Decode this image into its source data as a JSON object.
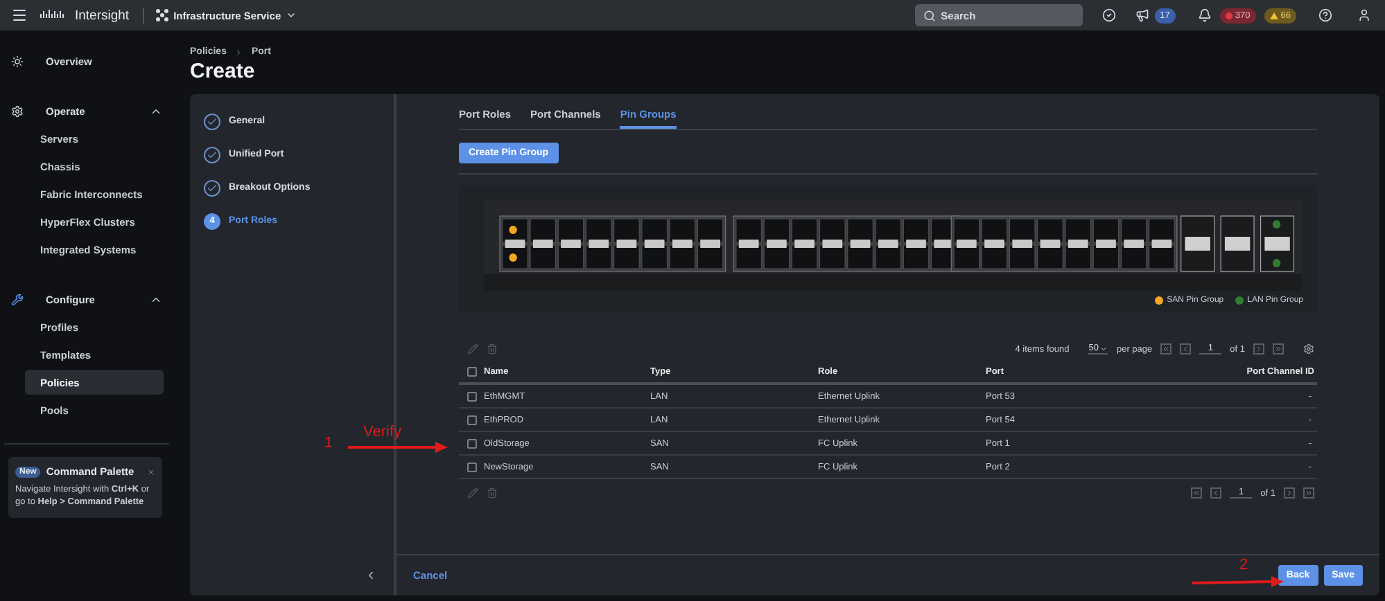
{
  "topbar": {
    "product": "Intersight",
    "service": "Infrastructure Service",
    "search": {
      "placeholder": "Search"
    },
    "badges": [
      {
        "kind": "info",
        "text": "17"
      },
      {
        "kind": "critical",
        "text": "370"
      },
      {
        "kind": "warning",
        "text": "66"
      }
    ]
  },
  "sidebar": {
    "sections": [
      {
        "label": "Overview",
        "expanded": false
      },
      {
        "label": "Operate",
        "expanded": true,
        "children": [
          {
            "label": "Servers",
            "selected": false
          },
          {
            "label": "Chassis",
            "selected": false
          },
          {
            "label": "Fabric Interconnects",
            "selected": false
          },
          {
            "label": "HyperFlex Clusters",
            "selected": false
          },
          {
            "label": "Integrated Systems",
            "selected": false
          }
        ]
      },
      {
        "label": "Configure",
        "expanded": true,
        "children": [
          {
            "label": "Profiles",
            "selected": false
          },
          {
            "label": "Templates",
            "selected": false
          },
          {
            "label": "Policies",
            "selected": true
          },
          {
            "label": "Pools",
            "selected": false
          }
        ]
      }
    ],
    "promo": {
      "badge": "New",
      "title": "Command Palette",
      "body": "Navigate Intersight with **Ctrl+K** or go to **Help > Command Palette**"
    }
  },
  "breadcrumb": [
    "Policies",
    "Port"
  ],
  "title": "Create",
  "steps": [
    {
      "label": "General",
      "completed": true,
      "selected": false
    },
    {
      "label": "Unified Port",
      "completed": true,
      "selected": false
    },
    {
      "label": "Breakout Options",
      "completed": true,
      "selected": false
    },
    {
      "label": "Port Roles",
      "completed": false,
      "selected": true,
      "number": "4"
    }
  ],
  "tabs": [
    {
      "label": "Port Roles",
      "selected": false
    },
    {
      "label": "Port Channels",
      "selected": false
    },
    {
      "label": "Pin Groups",
      "selected": true
    }
  ],
  "create_button": "Create Pin Group",
  "legend": [
    {
      "label": "SAN Pin Group",
      "color": "#f5a623"
    },
    {
      "label": "LAN Pin Group",
      "color": "#2e7d32"
    }
  ],
  "table": {
    "all_checked": false,
    "items_found": "4 items found",
    "per_page": "50",
    "per_page_label": "per page",
    "page": "1",
    "of": "of 1",
    "columns": [
      "Name",
      "Type",
      "Role",
      "Port",
      "Port Channel ID"
    ],
    "rows": [
      {
        "checked": false,
        "cells": [
          "EthMGMT",
          "LAN",
          "Ethernet Uplink",
          "Port 53",
          "-"
        ]
      },
      {
        "checked": false,
        "cells": [
          "EthPROD",
          "LAN",
          "Ethernet Uplink",
          "Port 54",
          "-"
        ]
      },
      {
        "checked": false,
        "cells": [
          "OldStorage",
          "SAN",
          "FC Uplink",
          "Port 1",
          "-"
        ]
      },
      {
        "checked": false,
        "cells": [
          "NewStorage",
          "SAN",
          "FC Uplink",
          "Port 2",
          "-"
        ]
      }
    ],
    "bottom_page": "1",
    "bottom_of": "of 1"
  },
  "footer": {
    "cancel": "Cancel",
    "back": "Back",
    "save": "Save"
  },
  "annotations": [
    {
      "number": "1",
      "label": "Verify"
    },
    {
      "number": "2"
    }
  ]
}
